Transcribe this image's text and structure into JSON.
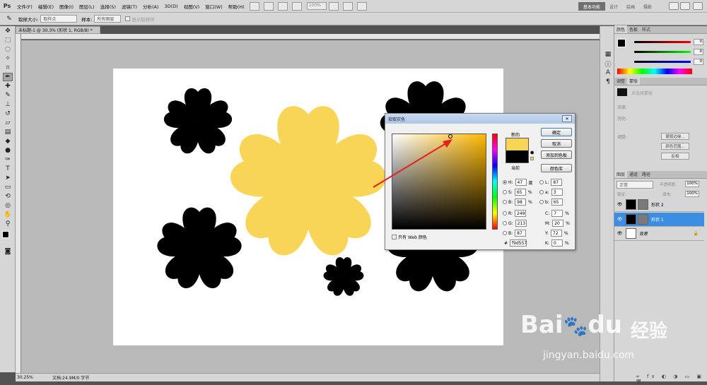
{
  "menubar": {
    "logo": "Ps",
    "items": [
      "文件(F)",
      "编辑(E)",
      "图像(I)",
      "图层(L)",
      "选择(S)",
      "滤镜(T)",
      "分析(A)",
      "3D(D)",
      "视图(V)",
      "窗口(W)",
      "帮助(H)"
    ],
    "zoom": "100%",
    "workspace_active": "基本功能",
    "workspace_links": [
      "设计",
      "绘画",
      "摄影"
    ]
  },
  "options": {
    "sample_size_label": "取样大小:",
    "sample_size_value": "取样点",
    "sample_label": "样本:",
    "sample_value": "所有图层",
    "ring_label": "显示取样环"
  },
  "document": {
    "tab_title": "未标题-1 @ 30.3% (形状 1, RGB/8) *",
    "zoom": "30.25%",
    "doc_info": "文档:24.9M/0 字节"
  },
  "picker": {
    "title": "拾取实色",
    "new_label": "新的",
    "current_label": "当前",
    "buttons": {
      "ok": "确定",
      "cancel": "取消",
      "add_swatch": "添加到色板",
      "libraries": "颜色库"
    },
    "web_only": "只有 Web 颜色",
    "fields": {
      "H": "47",
      "H_unit": "度",
      "S": "65",
      "S_unit": "%",
      "B": "98",
      "B_unit": "%",
      "L": "87",
      "a": "3",
      "b": "65",
      "R": "249",
      "G": "213",
      "Bl": "87",
      "C": "7",
      "M": "20",
      "Y": "72",
      "K": "0",
      "hex_label": "#",
      "hex": "f9d557"
    },
    "new_color": "#f9d557",
    "current_color": "#000000"
  },
  "color_panel": {
    "tabs": [
      "颜色",
      "色板",
      "样式"
    ],
    "r": "0",
    "g": "0",
    "b": "0"
  },
  "adjust_panel": {
    "tabs": [
      "调整",
      "蒙版"
    ],
    "no_selection": "未选择蒙版",
    "density_label": "浓度:",
    "feather_label": "羽化:",
    "refine_label": "调整:",
    "buttons": [
      "蒙版边缘...",
      "颜色范围...",
      "反相"
    ]
  },
  "layers_panel": {
    "tabs": [
      "图层",
      "通道",
      "路径"
    ],
    "blend_mode": "正常",
    "opacity_label": "不透明度:",
    "opacity": "100%",
    "lock_label": "锁定:",
    "fill_label": "填充:",
    "fill": "100%",
    "layers": [
      {
        "name": "形状 2",
        "selected": false
      },
      {
        "name": "形状 1",
        "selected": true
      },
      {
        "name": "背景",
        "selected": false
      }
    ]
  },
  "watermark": {
    "brand": "Bai",
    "brand2": "du",
    "cn": "经验",
    "url": "jingyan.baidu.com"
  },
  "colors": {
    "flower_yellow": "#f9d557",
    "flower_black": "#000000",
    "annotation_red": "#e8201a",
    "selected_layer": "#3b8ee2"
  }
}
